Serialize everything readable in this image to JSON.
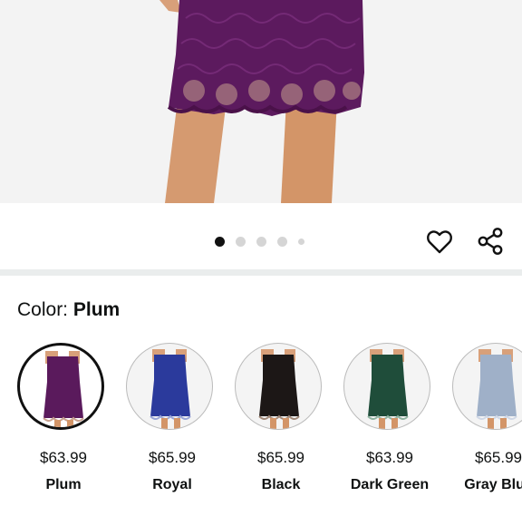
{
  "product_image": {
    "alt": "Plum lace dress",
    "gallery": {
      "total_images": 5,
      "active_index": 0
    }
  },
  "actions": {
    "favorite_icon": "heart-icon",
    "share_icon": "share-icon"
  },
  "color_selector": {
    "label": "Color: ",
    "selected": "Plum",
    "options": [
      {
        "name": "Plum",
        "price": "$63.99",
        "color": "#5a1a5c",
        "selected": true
      },
      {
        "name": "Royal",
        "price": "$65.99",
        "color": "#2b3a9c",
        "selected": false
      },
      {
        "name": "Black",
        "price": "$65.99",
        "color": "#1c1716",
        "selected": false
      },
      {
        "name": "Dark Green",
        "price": "$63.99",
        "color": "#1f4d3a",
        "selected": false
      },
      {
        "name": "Gray Blue",
        "price": "$65.99",
        "color": "#9fb0c8",
        "selected": false
      }
    ]
  }
}
